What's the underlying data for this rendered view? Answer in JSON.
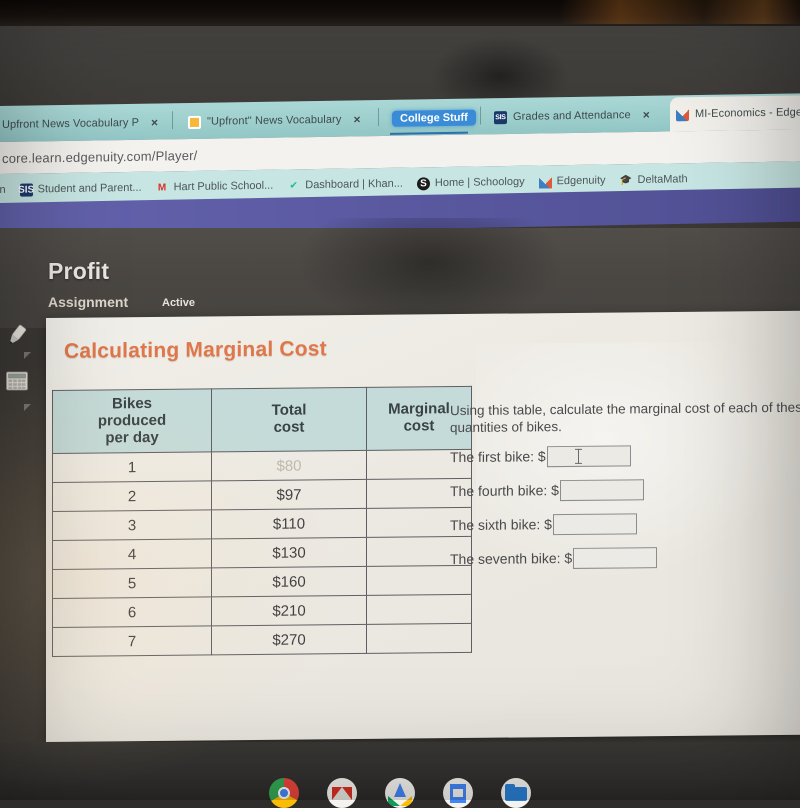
{
  "browser": {
    "tabs": [
      {
        "label": "Upfront News Vocabulary P",
        "close": "×",
        "favicon": "none"
      },
      {
        "label": "\"Upfront\" News Vocabulary",
        "close": "×",
        "favicon": "orange-doc-icon"
      },
      {
        "label": "College Stuff",
        "close": "",
        "favicon": "none"
      },
      {
        "label": "Grades and Attendance",
        "close": "×",
        "favicon": "sis-icon"
      },
      {
        "label": "MI-Economics - Edge",
        "close": "",
        "favicon": "edgenuity-x-icon"
      }
    ],
    "url": "core.learn.edgenuity.com/Player/",
    "bookmarks": [
      {
        "label": "tin",
        "icon": "none"
      },
      {
        "label": "Student and Parent...",
        "icon": "sis-icon"
      },
      {
        "label": "Hart Public School...",
        "icon": "gmail-icon"
      },
      {
        "label": "Dashboard | Khan...",
        "icon": "khan-icon"
      },
      {
        "label": "Home | Schoology",
        "icon": "schoology-icon"
      },
      {
        "label": "Edgenuity",
        "icon": "edgenuity-x-icon"
      },
      {
        "label": "DeltaMath",
        "icon": "deltamath-cap-icon"
      }
    ]
  },
  "lesson": {
    "title": "Profit",
    "type": "Assignment",
    "state": "Active"
  },
  "tools": [
    {
      "name": "highlighter-tool",
      "icon": "pencil-icon"
    },
    {
      "name": "calculator-tool",
      "icon": "calculator-icon"
    }
  ],
  "card": {
    "title": "Calculating Marginal Cost",
    "table": {
      "headers": [
        "Bikes produced per day",
        "Total cost",
        "Marginal cost"
      ],
      "header_lines": [
        [
          "Bikes",
          "produced",
          "per day"
        ],
        [
          "Total",
          "cost"
        ],
        [
          "Marginal",
          "cost"
        ]
      ],
      "rows": [
        {
          "bikes": "1",
          "total_cost": "$80",
          "marginal_cost": ""
        },
        {
          "bikes": "2",
          "total_cost": "$97",
          "marginal_cost": ""
        },
        {
          "bikes": "3",
          "total_cost": "$110",
          "marginal_cost": ""
        },
        {
          "bikes": "4",
          "total_cost": "$130",
          "marginal_cost": ""
        },
        {
          "bikes": "5",
          "total_cost": "$160",
          "marginal_cost": ""
        },
        {
          "bikes": "6",
          "total_cost": "$210",
          "marginal_cost": ""
        },
        {
          "bikes": "7",
          "total_cost": "$270",
          "marginal_cost": ""
        }
      ]
    },
    "prompt": "Using this table, calculate the marginal cost of each of these quantities of bikes.",
    "questions": [
      {
        "label": "The first bike: $",
        "value": ""
      },
      {
        "label": "The fourth bike: $",
        "value": ""
      },
      {
        "label": "The sixth bike: $",
        "value": ""
      },
      {
        "label": "The seventh bike: $",
        "value": ""
      }
    ]
  },
  "shelf": {
    "apps": [
      {
        "name": "chrome-icon"
      },
      {
        "name": "gmail-icon"
      },
      {
        "name": "drive-icon"
      },
      {
        "name": "slides-icon"
      },
      {
        "name": "files-icon"
      }
    ]
  },
  "colors": {
    "tabstrip": "#9bd3d1",
    "bookmarks_bar": "#c7e6e3",
    "edgenuity_band": "#5b5aa8",
    "card_title": "#e0774a",
    "table_header": "#c4dbd9",
    "active_tab_pill": "#3b8dd8"
  }
}
